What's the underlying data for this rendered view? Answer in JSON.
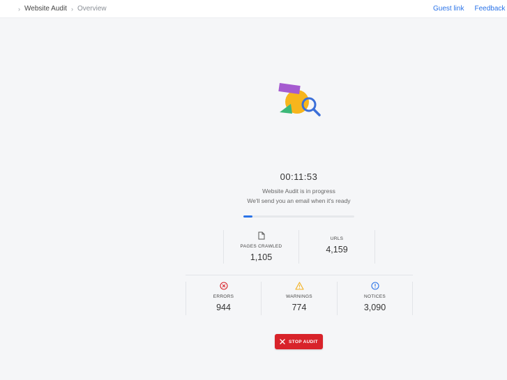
{
  "breadcrumb": {
    "items": [
      "Website Audit",
      "Overview"
    ]
  },
  "top_links": {
    "guest_link": "Guest link",
    "feedback": "Feedback"
  },
  "audit": {
    "timer": "00:11:53",
    "status_line1": "Website Audit is in progress",
    "status_line2": "We'll send you an email when it's ready",
    "progress_fraction": 0.08
  },
  "stats": {
    "pages_crawled": {
      "label": "PAGES CRAWLED",
      "value": "1,105",
      "icon": "document-icon"
    },
    "urls": {
      "label": "URLS",
      "value": "4,159"
    }
  },
  "issues": {
    "errors": {
      "label": "ERRORS",
      "value": "944",
      "icon": "error-circle-icon",
      "color": "#d8232a"
    },
    "warnings": {
      "label": "WARNINGS",
      "value": "774",
      "icon": "warning-triangle-icon",
      "color": "#f2b01e"
    },
    "notices": {
      "label": "NOTICES",
      "value": "3,090",
      "icon": "info-circle-icon",
      "color": "#2a73e8"
    }
  },
  "actions": {
    "stop_audit_label": "STOP AUDIT",
    "stop_color": "#d8232a"
  }
}
